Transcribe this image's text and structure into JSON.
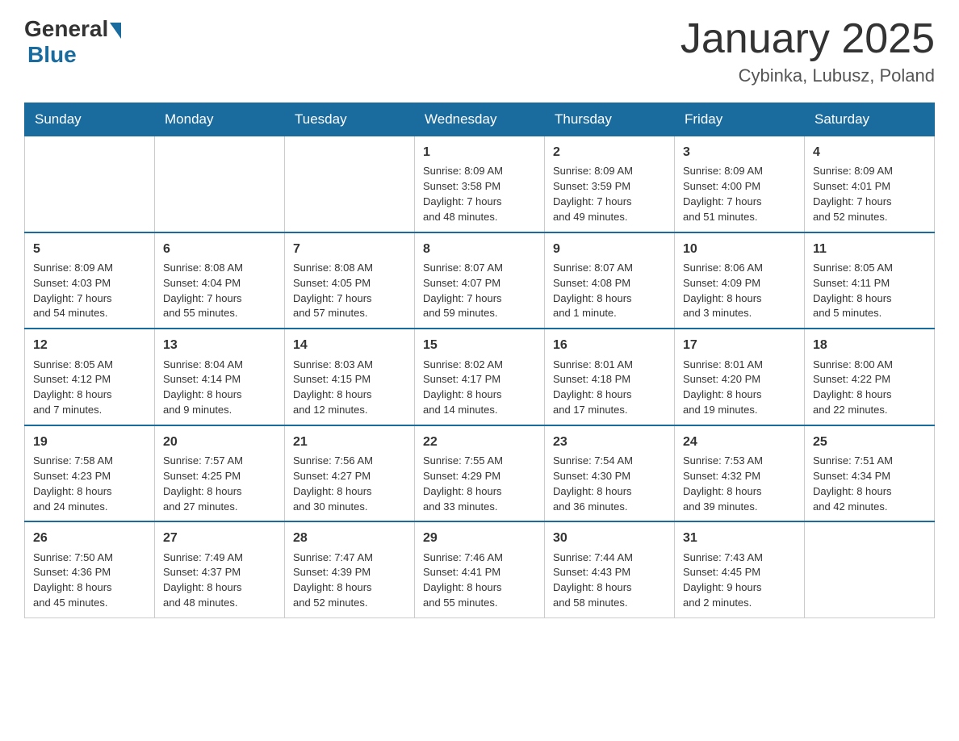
{
  "logo": {
    "general": "General",
    "blue": "Blue"
  },
  "title": "January 2025",
  "location": "Cybinka, Lubusz, Poland",
  "days_header": [
    "Sunday",
    "Monday",
    "Tuesday",
    "Wednesday",
    "Thursday",
    "Friday",
    "Saturday"
  ],
  "weeks": [
    [
      {
        "day": "",
        "info": ""
      },
      {
        "day": "",
        "info": ""
      },
      {
        "day": "",
        "info": ""
      },
      {
        "day": "1",
        "info": "Sunrise: 8:09 AM\nSunset: 3:58 PM\nDaylight: 7 hours\nand 48 minutes."
      },
      {
        "day": "2",
        "info": "Sunrise: 8:09 AM\nSunset: 3:59 PM\nDaylight: 7 hours\nand 49 minutes."
      },
      {
        "day": "3",
        "info": "Sunrise: 8:09 AM\nSunset: 4:00 PM\nDaylight: 7 hours\nand 51 minutes."
      },
      {
        "day": "4",
        "info": "Sunrise: 8:09 AM\nSunset: 4:01 PM\nDaylight: 7 hours\nand 52 minutes."
      }
    ],
    [
      {
        "day": "5",
        "info": "Sunrise: 8:09 AM\nSunset: 4:03 PM\nDaylight: 7 hours\nand 54 minutes."
      },
      {
        "day": "6",
        "info": "Sunrise: 8:08 AM\nSunset: 4:04 PM\nDaylight: 7 hours\nand 55 minutes."
      },
      {
        "day": "7",
        "info": "Sunrise: 8:08 AM\nSunset: 4:05 PM\nDaylight: 7 hours\nand 57 minutes."
      },
      {
        "day": "8",
        "info": "Sunrise: 8:07 AM\nSunset: 4:07 PM\nDaylight: 7 hours\nand 59 minutes."
      },
      {
        "day": "9",
        "info": "Sunrise: 8:07 AM\nSunset: 4:08 PM\nDaylight: 8 hours\nand 1 minute."
      },
      {
        "day": "10",
        "info": "Sunrise: 8:06 AM\nSunset: 4:09 PM\nDaylight: 8 hours\nand 3 minutes."
      },
      {
        "day": "11",
        "info": "Sunrise: 8:05 AM\nSunset: 4:11 PM\nDaylight: 8 hours\nand 5 minutes."
      }
    ],
    [
      {
        "day": "12",
        "info": "Sunrise: 8:05 AM\nSunset: 4:12 PM\nDaylight: 8 hours\nand 7 minutes."
      },
      {
        "day": "13",
        "info": "Sunrise: 8:04 AM\nSunset: 4:14 PM\nDaylight: 8 hours\nand 9 minutes."
      },
      {
        "day": "14",
        "info": "Sunrise: 8:03 AM\nSunset: 4:15 PM\nDaylight: 8 hours\nand 12 minutes."
      },
      {
        "day": "15",
        "info": "Sunrise: 8:02 AM\nSunset: 4:17 PM\nDaylight: 8 hours\nand 14 minutes."
      },
      {
        "day": "16",
        "info": "Sunrise: 8:01 AM\nSunset: 4:18 PM\nDaylight: 8 hours\nand 17 minutes."
      },
      {
        "day": "17",
        "info": "Sunrise: 8:01 AM\nSunset: 4:20 PM\nDaylight: 8 hours\nand 19 minutes."
      },
      {
        "day": "18",
        "info": "Sunrise: 8:00 AM\nSunset: 4:22 PM\nDaylight: 8 hours\nand 22 minutes."
      }
    ],
    [
      {
        "day": "19",
        "info": "Sunrise: 7:58 AM\nSunset: 4:23 PM\nDaylight: 8 hours\nand 24 minutes."
      },
      {
        "day": "20",
        "info": "Sunrise: 7:57 AM\nSunset: 4:25 PM\nDaylight: 8 hours\nand 27 minutes."
      },
      {
        "day": "21",
        "info": "Sunrise: 7:56 AM\nSunset: 4:27 PM\nDaylight: 8 hours\nand 30 minutes."
      },
      {
        "day": "22",
        "info": "Sunrise: 7:55 AM\nSunset: 4:29 PM\nDaylight: 8 hours\nand 33 minutes."
      },
      {
        "day": "23",
        "info": "Sunrise: 7:54 AM\nSunset: 4:30 PM\nDaylight: 8 hours\nand 36 minutes."
      },
      {
        "day": "24",
        "info": "Sunrise: 7:53 AM\nSunset: 4:32 PM\nDaylight: 8 hours\nand 39 minutes."
      },
      {
        "day": "25",
        "info": "Sunrise: 7:51 AM\nSunset: 4:34 PM\nDaylight: 8 hours\nand 42 minutes."
      }
    ],
    [
      {
        "day": "26",
        "info": "Sunrise: 7:50 AM\nSunset: 4:36 PM\nDaylight: 8 hours\nand 45 minutes."
      },
      {
        "day": "27",
        "info": "Sunrise: 7:49 AM\nSunset: 4:37 PM\nDaylight: 8 hours\nand 48 minutes."
      },
      {
        "day": "28",
        "info": "Sunrise: 7:47 AM\nSunset: 4:39 PM\nDaylight: 8 hours\nand 52 minutes."
      },
      {
        "day": "29",
        "info": "Sunrise: 7:46 AM\nSunset: 4:41 PM\nDaylight: 8 hours\nand 55 minutes."
      },
      {
        "day": "30",
        "info": "Sunrise: 7:44 AM\nSunset: 4:43 PM\nDaylight: 8 hours\nand 58 minutes."
      },
      {
        "day": "31",
        "info": "Sunrise: 7:43 AM\nSunset: 4:45 PM\nDaylight: 9 hours\nand 2 minutes."
      },
      {
        "day": "",
        "info": ""
      }
    ]
  ]
}
